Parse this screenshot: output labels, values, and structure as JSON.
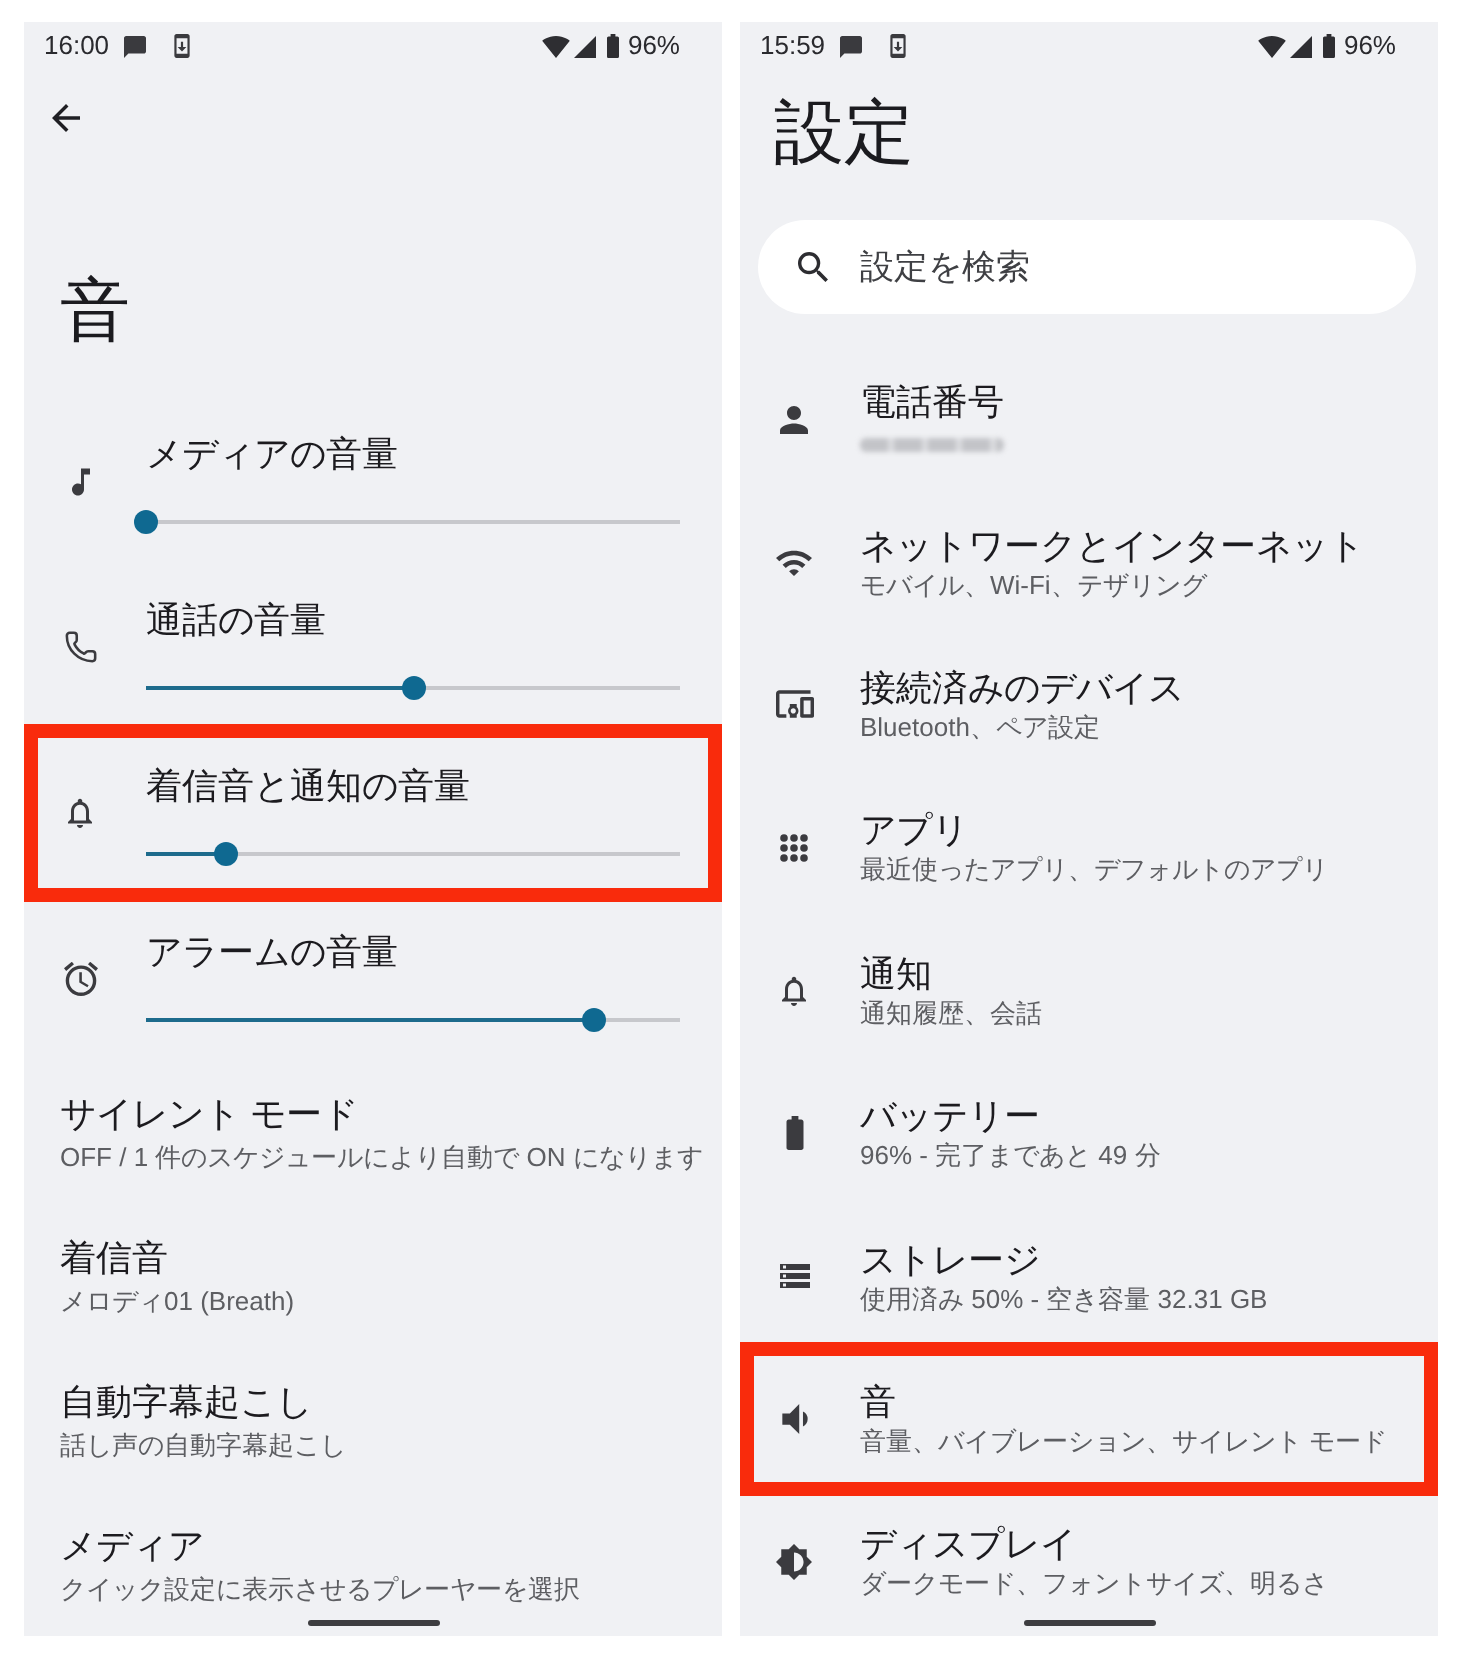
{
  "left_screen": {
    "status_bar": {
      "time": "16:00",
      "battery": "96%"
    },
    "title": "音",
    "volume_rows": [
      {
        "label": "メディアの音量",
        "level": 0,
        "highlighted": false
      },
      {
        "label": "通話の音量",
        "level": 0.5,
        "highlighted": false
      },
      {
        "label": "着信音と通知の音量",
        "level": 0.15,
        "highlighted": true
      },
      {
        "label": "アラームの音量",
        "level": 0.84,
        "highlighted": false
      }
    ],
    "items": [
      {
        "title": "サイレント モード",
        "subtitle": "OFF / 1 件のスケジュールにより自動で ON になります"
      },
      {
        "title": "着信音",
        "subtitle": "メロディ01 (Breath)"
      },
      {
        "title": "自動字幕起こし",
        "subtitle": "話し声の自動字幕起こし"
      },
      {
        "title": "メディア",
        "subtitle": "クイック設定に表示させるプレーヤーを選択"
      }
    ]
  },
  "right_screen": {
    "status_bar": {
      "time": "15:59",
      "battery": "96%"
    },
    "title": "設定",
    "search": {
      "placeholder": "設定を検索"
    },
    "items": [
      {
        "title": "電話番号",
        "redacted": true,
        "highlighted": false
      },
      {
        "title": "ネットワークとインターネット",
        "subtitle": "モバイル、Wi-Fi、テザリング",
        "redacted": false,
        "highlighted": false
      },
      {
        "title": "接続済みのデバイス",
        "subtitle": "Bluetooth、ペア設定",
        "redacted": false,
        "highlighted": false
      },
      {
        "title": "アプリ",
        "subtitle": "最近使ったアプリ、デフォルトのアプリ",
        "redacted": false,
        "highlighted": false
      },
      {
        "title": "通知",
        "subtitle": "通知履歴、会話",
        "redacted": false,
        "highlighted": false
      },
      {
        "title": "バッテリー",
        "subtitle": "96% - 完了まであと 49 分",
        "redacted": false,
        "highlighted": false
      },
      {
        "title": "ストレージ",
        "subtitle": "使用済み 50% - 空き容量 32.31 GB",
        "redacted": false,
        "highlighted": false
      },
      {
        "title": "音",
        "subtitle": "音量、バイブレーション、サイレント モード",
        "redacted": false,
        "highlighted": true
      },
      {
        "title": "ディスプレイ",
        "subtitle": "ダークモード、フォントサイズ、明るさ",
        "redacted": false,
        "highlighted": false
      }
    ]
  }
}
